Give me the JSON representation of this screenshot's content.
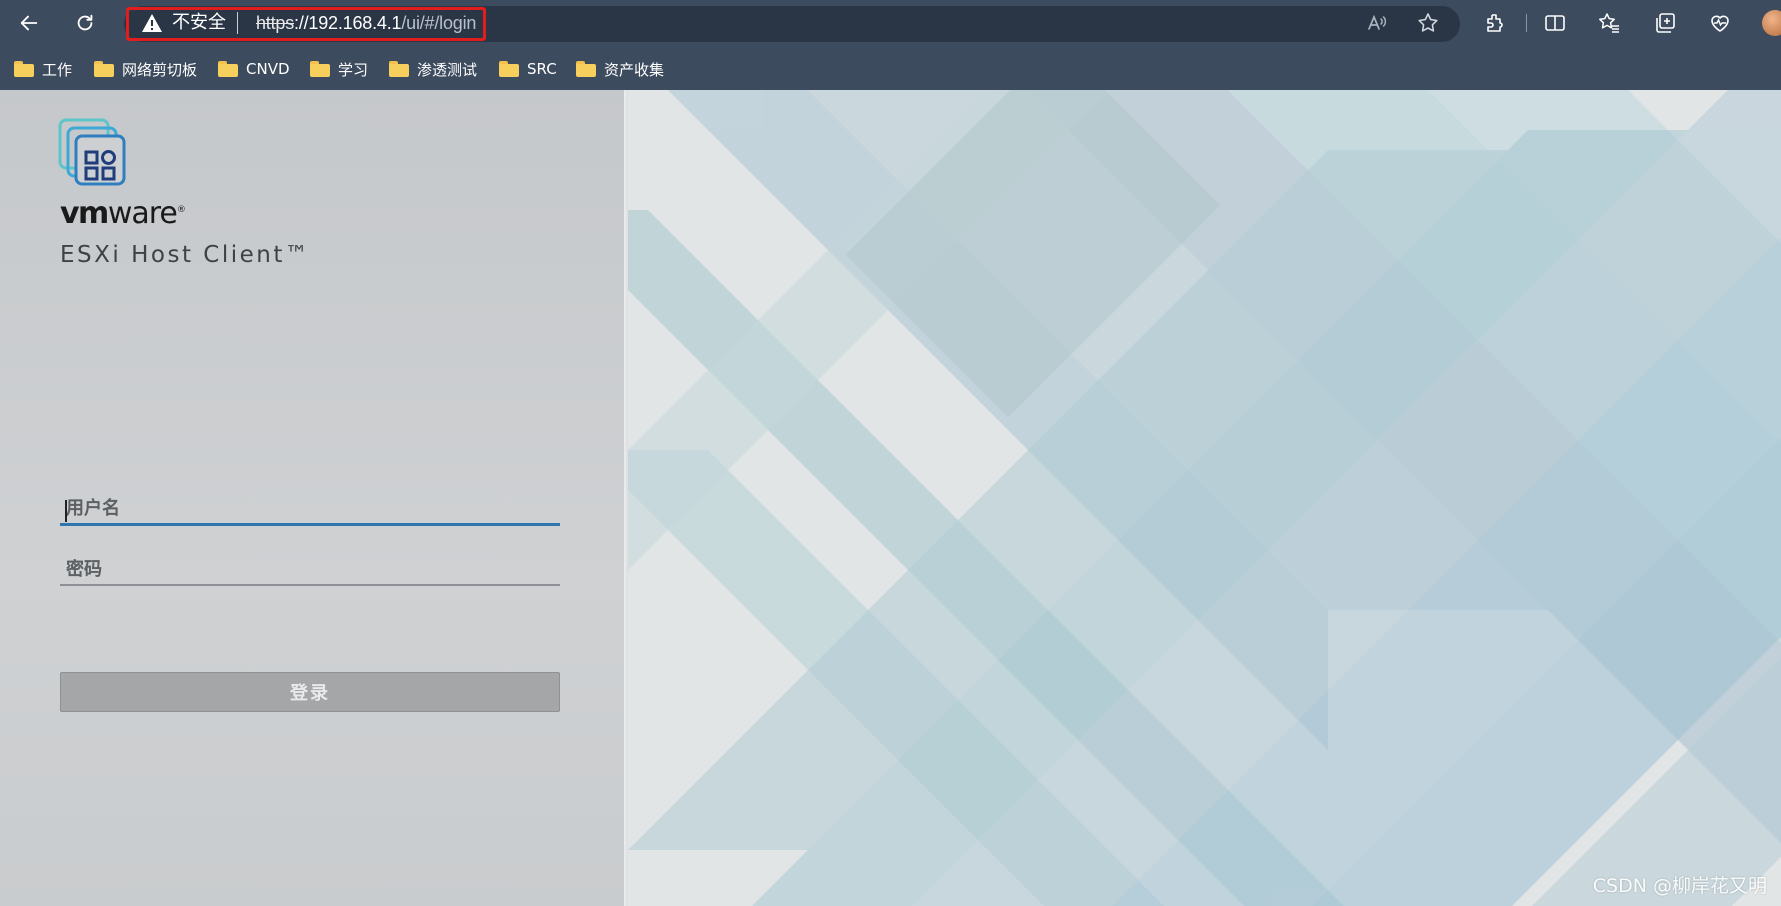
{
  "browser": {
    "security_label": "不安全",
    "url_protocol": "https",
    "url_host": "://192.168.4.1",
    "url_path": "/ui/#/login",
    "icons": [
      "back-icon",
      "refresh-icon",
      "warning-icon",
      "read-aloud-icon",
      "favorite-star-icon",
      "extensions-icon",
      "split-screen-icon",
      "favorites-icon",
      "collections-icon",
      "browser-essentials-icon",
      "profile-avatar"
    ]
  },
  "bookmarks": [
    {
      "label": "工作"
    },
    {
      "label": "网络剪切板"
    },
    {
      "label": "CNVD"
    },
    {
      "label": "学习"
    },
    {
      "label": "渗透测试"
    },
    {
      "label": "SRC"
    },
    {
      "label": "资产收集"
    }
  ],
  "login": {
    "brand_vm": "vm",
    "brand_ware": "ware",
    "brand_reg": "®",
    "product": "ESXi Host Client™",
    "username_placeholder": "用户名",
    "password_placeholder": "密码",
    "login_button": "登录"
  },
  "watermark": "CSDN @柳岸花又明",
  "colors": {
    "toolbar": "#3d4b5e",
    "url_highlight": "#e21d1d",
    "input_focus": "#2f76ae",
    "login_button": "#a4a6a7"
  }
}
